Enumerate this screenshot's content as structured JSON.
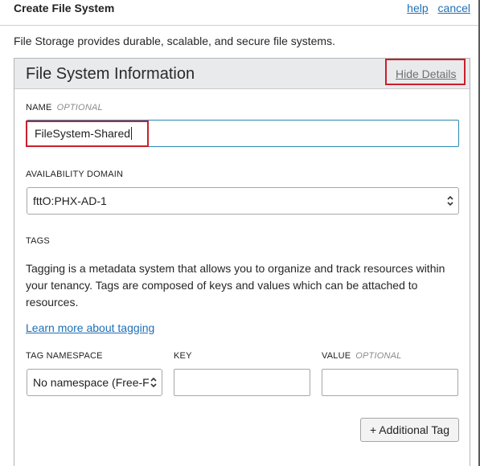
{
  "header": {
    "title": "Create File System",
    "help": "help",
    "cancel": "cancel"
  },
  "intro": "File Storage provides durable, scalable, and secure file systems.",
  "panel": {
    "title": "File System Information",
    "hide_details": "Hide Details"
  },
  "name": {
    "label": "NAME",
    "optional": "OPTIONAL",
    "value": "FileSystem-Shared"
  },
  "availability_domain": {
    "label": "AVAILABILITY DOMAIN",
    "value": "fttO:PHX-AD-1"
  },
  "tags": {
    "label": "TAGS",
    "description": "Tagging is a metadata system that allows you to organize and track resources within your tenancy. Tags are composed of keys and values which can be attached to resources.",
    "learn_more": "Learn more about tagging",
    "namespace_label": "TAG NAMESPACE",
    "namespace_value": "No namespace (Free-F",
    "key_label": "KEY",
    "key_value": "",
    "value_label": "VALUE",
    "value_optional": "OPTIONAL",
    "value_value": "",
    "add_tag": "+ Additional Tag"
  },
  "icons": {
    "select_arrows": "chevron-up-down-icon"
  },
  "colors": {
    "link": "#1f6fb5",
    "highlight": "#c8202b",
    "focus_border": "#2b87b4",
    "panel_header_bg": "#e9eaec"
  }
}
